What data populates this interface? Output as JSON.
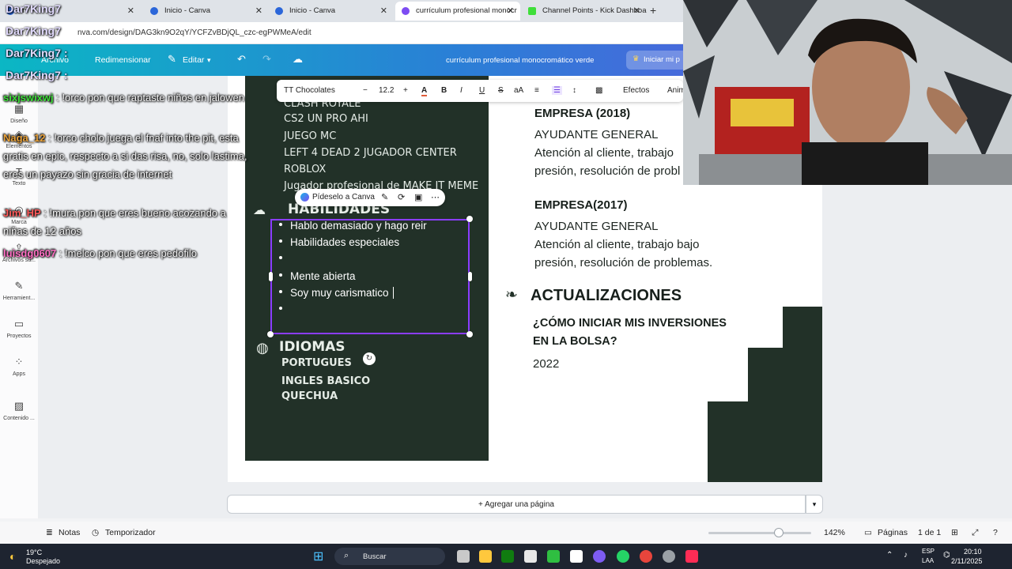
{
  "browser": {
    "tabs": [
      {
        "title": "Ini",
        "close": "✕"
      },
      {
        "title": "Inicio - Canva",
        "close": "✕"
      },
      {
        "title": "Inicio - Canva",
        "close": "✕"
      },
      {
        "title": "currículum profesional monocr",
        "close": "✕"
      },
      {
        "title": "Channel Points - Kick Dashboa",
        "close": "✕"
      }
    ],
    "new_tab": "+",
    "url": "nva.com/design/DAG3kn9O2qY/YCFZvBDjQL_czc-egPWMeA/edit"
  },
  "topbar": {
    "file": "Archivo",
    "resize": "Redimensionar",
    "edit": "Editar",
    "title": "currículum profesional  monocromático verde",
    "present": "Iniciar mi p"
  },
  "sidebar": [
    {
      "label": "Diseño",
      "icon": "layout-icon"
    },
    {
      "label": "Elementos",
      "icon": "shapes-icon"
    },
    {
      "label": "Texto",
      "icon": "text-icon"
    },
    {
      "label": "Marca",
      "icon": "brand-icon"
    },
    {
      "label": "Archivos su...",
      "icon": "upload-icon"
    },
    {
      "label": "Herramient...",
      "icon": "tools-icon"
    },
    {
      "label": "Proyectos",
      "icon": "folder-icon"
    },
    {
      "label": "Apps",
      "icon": "apps-icon"
    },
    {
      "label": "Contenido ...",
      "icon": "content-icon"
    }
  ],
  "format_toolbar": {
    "font": "TT Chocolates",
    "minus": "−",
    "size": "12.2",
    "plus": "+",
    "bold": "B",
    "italic": "I",
    "underline": "U",
    "strike": "S",
    "case": "aA",
    "effects": "Efectos",
    "animate": "Anim"
  },
  "ai_pill": {
    "label": "Pídeselo a Canva"
  },
  "resume": {
    "left_list": [
      "CLASH ROYALE",
      "CS2 UN PRO AHI",
      "JUEGO MC",
      "LEFT 4 DEAD 2 JUGADOR CENTER",
      "ROBLOX",
      "Jugador profesional de MAKE IT MEME"
    ],
    "skills_heading": "HABILIDADES",
    "skills": [
      "Hablo demasiado y hago reir",
      "Habilidades especiales",
      "",
      "Mente abierta",
      "Soy muy carismatico",
      ""
    ],
    "languages_heading": "IDIOMAS",
    "languages": [
      "PORTUGUES",
      "INGLES BASICO",
      "QUECHUA"
    ],
    "jobs": [
      {
        "company": "EMPRESA (2018)",
        "role": "AYUDANTE GENERAL",
        "desc1": "Atención al cliente, trabajo",
        "desc2": "presión, resolución de probl"
      },
      {
        "company": "EMPRESA(2017)",
        "role": "AYUDANTE GENERAL",
        "desc1": "Atención al cliente, trabajo bajo",
        "desc2": "presión, resolución de problemas."
      }
    ],
    "updates_heading": "ACTUALIZACIONES",
    "question1": "¿CÓMO INICIAR MIS INVERSIONES",
    "question2": "EN LA BOLSA?",
    "year": "2022"
  },
  "add_page": "+ Agregar una página",
  "status": {
    "notes": "Notas",
    "timer": "Temporizador",
    "zoom": "142%",
    "zoom_fraction": 0.64,
    "pages": "Páginas",
    "page_count": "1 de 1"
  },
  "taskbar": {
    "weather_temp": "19°C",
    "weather_text": "Despejado",
    "search": "Buscar",
    "lang1": "ESP",
    "lang2": "LAA",
    "time": "20:10",
    "date": "2/11/2025"
  },
  "chat": [
    {
      "user": "Dar7King7",
      "text": "",
      "color": "#d9d3ff"
    },
    {
      "user": "Dar7King7",
      "text": "",
      "color": "#d9d3ff"
    },
    {
      "user": "Dar7King7",
      "text": ":",
      "color": "#d9d3ff"
    },
    {
      "user": "Dar7King7",
      "text": ":",
      "color": "#d9d3ff"
    },
    {
      "user": "sixjswixwj",
      "text": ": !orco pon que raptaste niños en jalowen",
      "color": "#3fdf3a"
    },
    {
      "user": "Naga_12",
      "text": ": !orco cholo juega el fnaf into the pit, esta gratis en epic, respecto a si das risa, no, solo lastima, eres un payazo sin gracia de internet",
      "color": "#e8a13a"
    },
    {
      "user": "Jim_HP",
      "text": ": !mura pon que eres bueno acozando a niñas de 12 años",
      "color": "#ff5a5a"
    },
    {
      "user": "luisdg0607",
      "text": ": !melco pon que eres pedofilo",
      "color": "#ff6fc4"
    }
  ],
  "colors": {
    "canva_purple": "#8b3dff",
    "resume_dark": "#223128",
    "topbar_start": "#0bb7c4",
    "topbar_end": "#6f4ce3"
  }
}
